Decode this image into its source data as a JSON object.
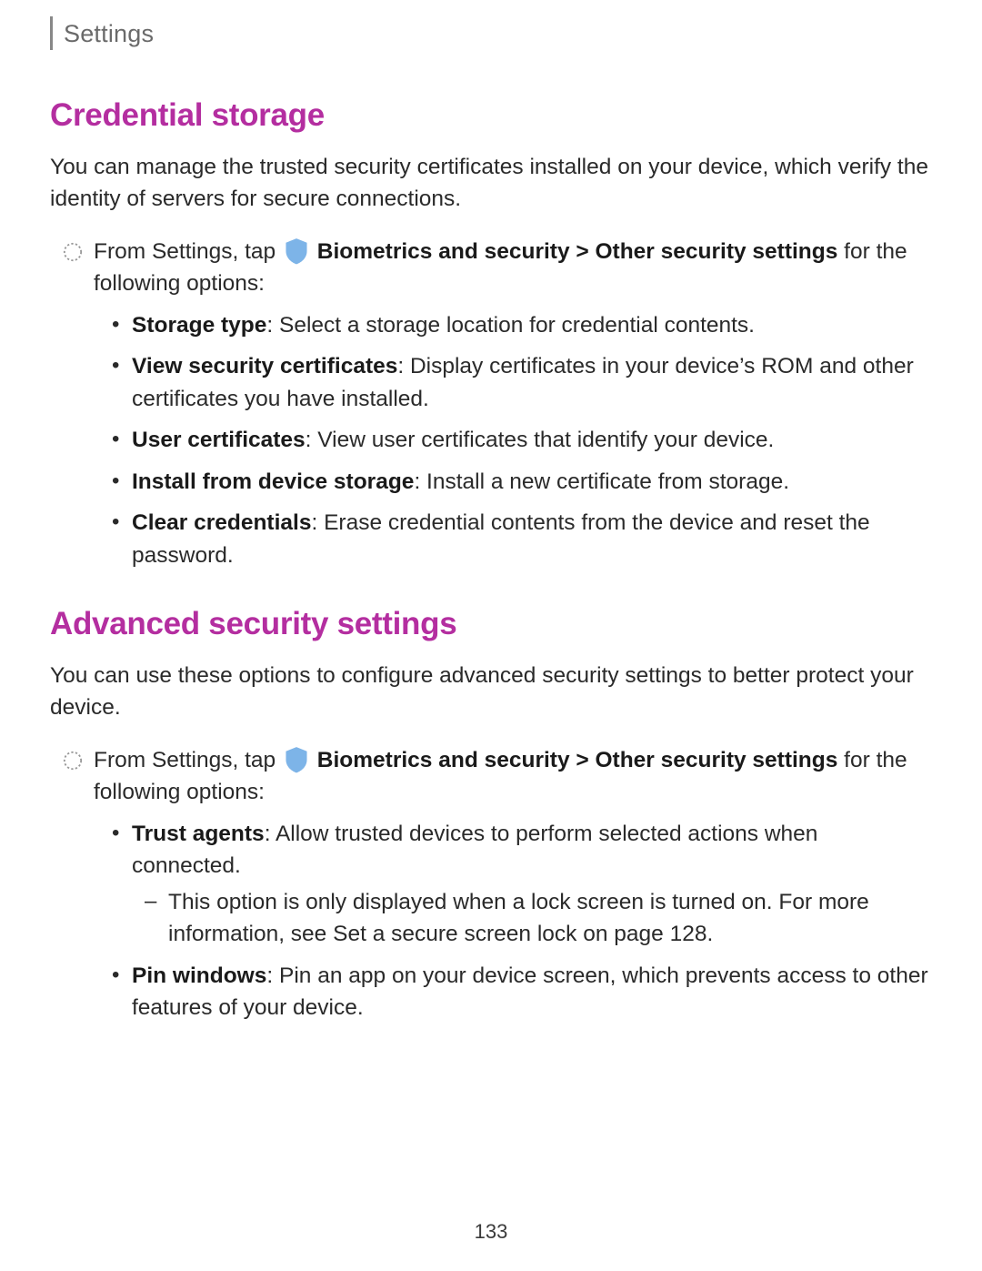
{
  "header": {
    "label": "Settings"
  },
  "sections": [
    {
      "title": "Credential storage",
      "intro": "You can manage the trusted security certificates installed on your device, which verify the identity of servers for secure connections.",
      "step_prefix": "From Settings, tap ",
      "step_menu1": "Biometrics and security",
      "step_chev": " > ",
      "step_menu2": "Other security settings",
      "step_suffix": " for the following options:",
      "items": [
        {
          "term": "Storage type",
          "desc": ": Select a storage location for credential contents."
        },
        {
          "term": "View security certificates",
          "desc": ": Display certificates in your device’s ROM and other certificates you have installed."
        },
        {
          "term": "User certificates",
          "desc": ": View user certificates that identify your device."
        },
        {
          "term": "Install from device storage",
          "desc": ": Install a new certificate from storage."
        },
        {
          "term": "Clear credentials",
          "desc": ": Erase credential contents from the device and reset the password."
        }
      ]
    },
    {
      "title": "Advanced security settings",
      "intro": "You can use these options to configure advanced security settings to better protect your device.",
      "step_prefix": "From Settings, tap ",
      "step_menu1": "Biometrics and security",
      "step_chev": " > ",
      "step_menu2": "Other security settings",
      "step_suffix": " for the following options:",
      "items": [
        {
          "term": "Trust agents",
          "desc": ": Allow trusted devices to perform selected actions when connected.",
          "sub": {
            "pre": "This option is only displayed when a lock screen is turned on. For more information, see ",
            "link": "Set a secure screen lock",
            "post": " on page 128."
          }
        },
        {
          "term": "Pin windows",
          "desc": ": Pin an app on your device screen, which prevents access to other features of your device."
        }
      ]
    }
  ],
  "page_number": "133"
}
